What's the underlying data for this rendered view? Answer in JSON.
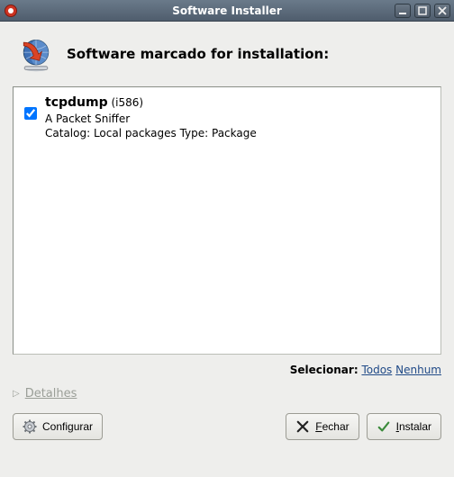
{
  "window": {
    "title": "Software Installer"
  },
  "header": {
    "text": "Software marcado for installation:"
  },
  "packages": [
    {
      "name": "tcpdump",
      "arch": "(i586)",
      "description": "A Packet Sniffer",
      "meta": "Catalog: Local packages Type: Package",
      "checked": true
    }
  ],
  "select": {
    "label": "Selecionar:",
    "all": "Todos",
    "none": "Nenhum"
  },
  "details": {
    "label": "Detalhes"
  },
  "buttons": {
    "configure": "Configurar",
    "close_full": "Fechar",
    "close_pre": "",
    "close_u": "F",
    "close_post": "echar",
    "install_full": "Instalar",
    "install_pre": "",
    "install_u": "I",
    "install_post": "nstalar"
  }
}
